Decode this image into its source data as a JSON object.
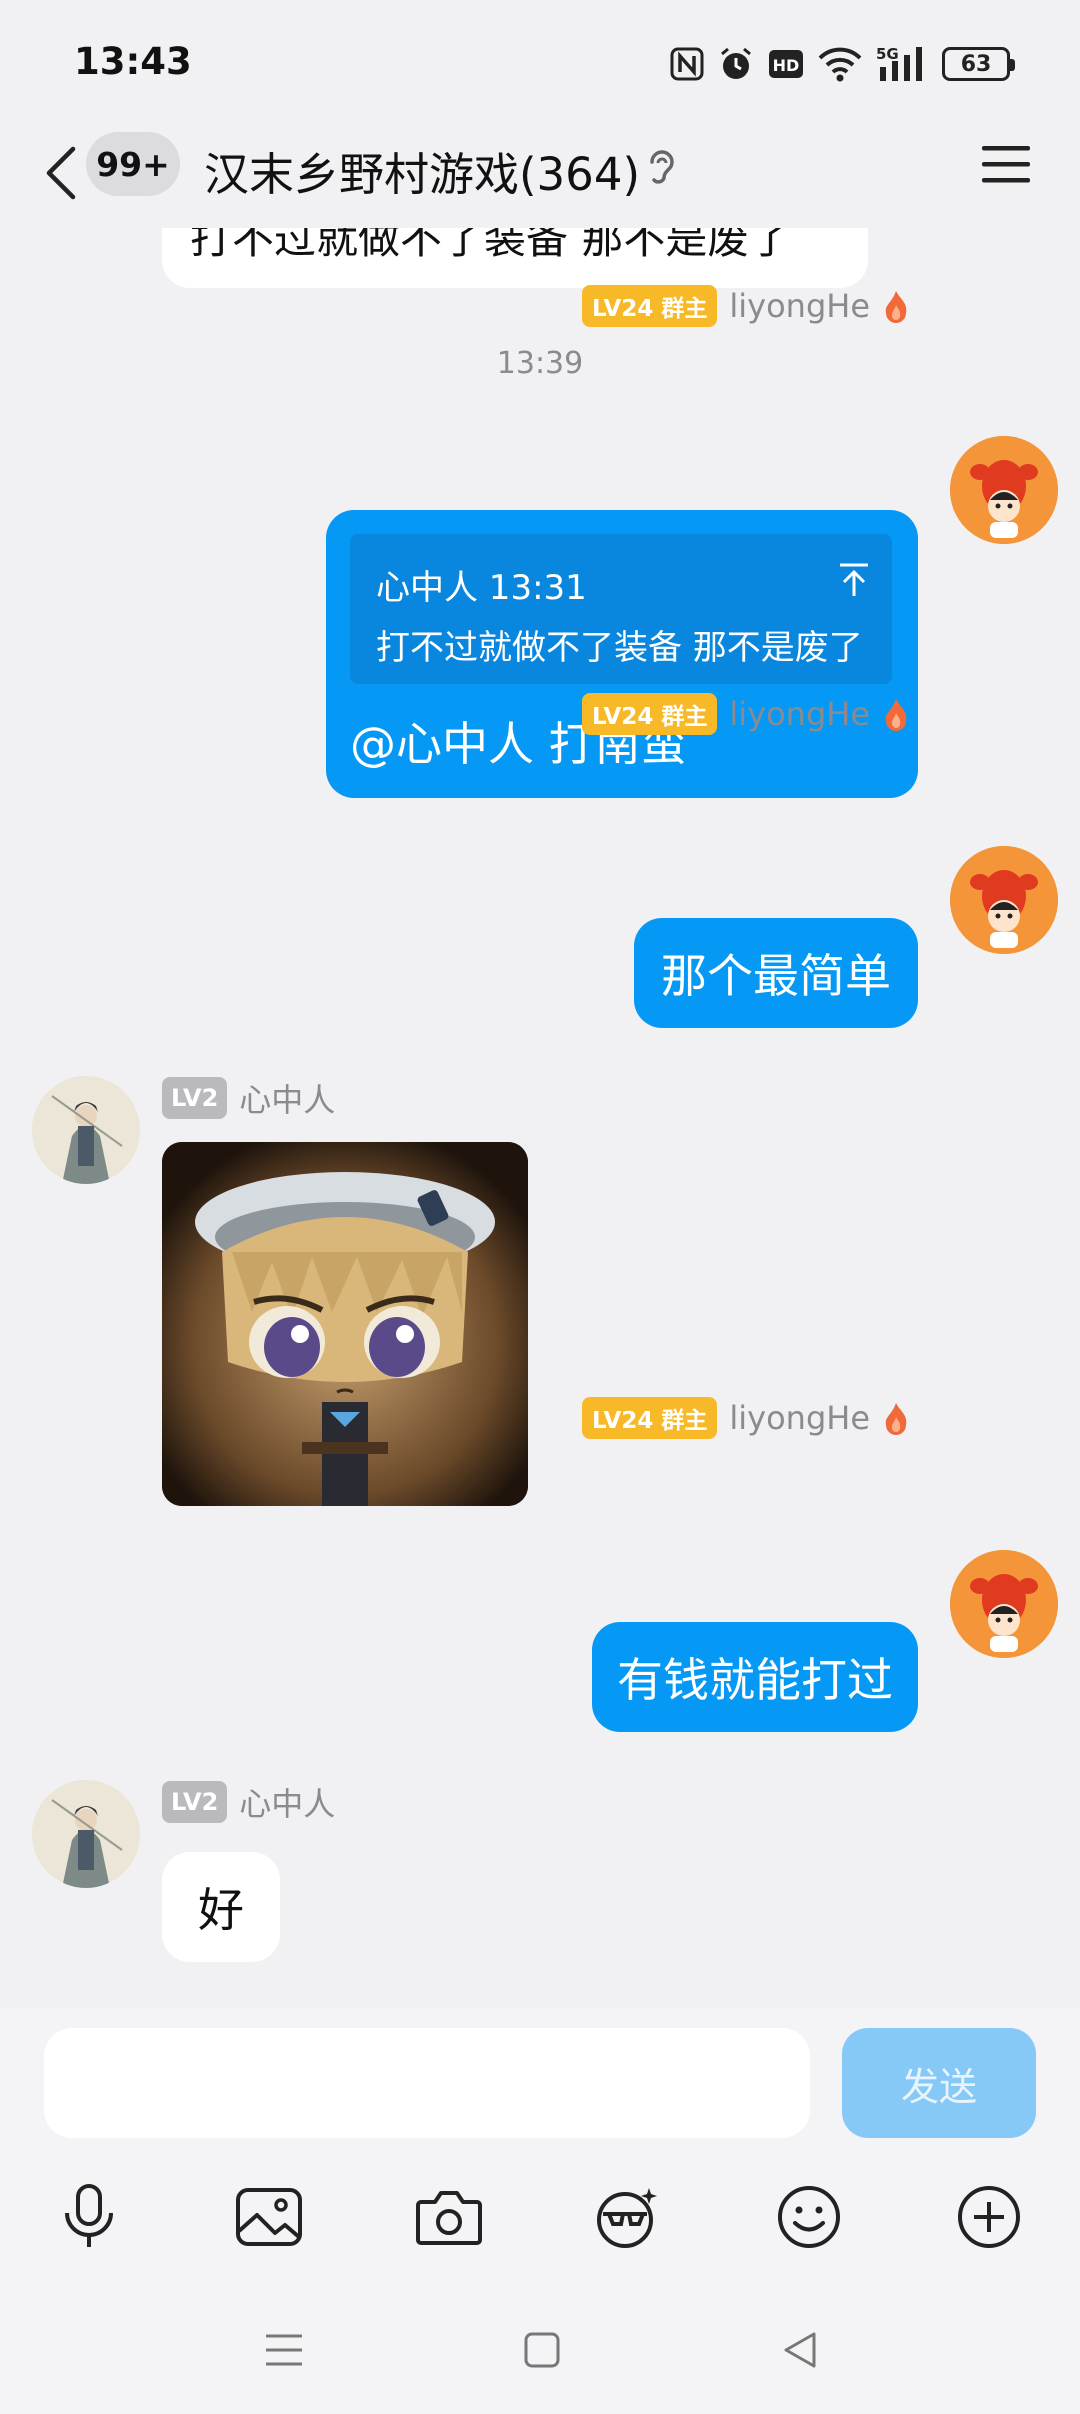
{
  "status_bar": {
    "time": "13:43",
    "network": "5G",
    "hd": "HD",
    "battery": "63"
  },
  "header": {
    "unread_count": "99+",
    "title": "汉末乡野村游戏(364)"
  },
  "messages": {
    "top_partial_text": "打不过就做不了装备 那不是废了",
    "timestamp": "13:39",
    "msg1": {
      "badge": "LV24 群主",
      "sender": "liyongHe",
      "quote_sender_time": "心中人 13:31",
      "quote_text": "打不过就做不了装备 那不是废了",
      "text": "@心中人 打南蛮"
    },
    "msg2": {
      "badge": "LV24 群主",
      "sender": "liyongHe",
      "text": "那个最简单"
    },
    "msg3": {
      "badge": "LV2",
      "sender": "心中人"
    },
    "msg4": {
      "badge": "LV24 群主",
      "sender": "liyongHe",
      "text": "有钱就能打过"
    },
    "msg5": {
      "badge": "LV2",
      "sender": "心中人",
      "text": "好"
    }
  },
  "input": {
    "value": "",
    "send_label": "发送"
  },
  "toolbar": [
    "microphone-icon",
    "image-icon",
    "camera-icon",
    "sticker-icon",
    "emoji-icon",
    "plus-icon"
  ],
  "colors": {
    "bubble_blue": "#0599f5",
    "owner_badge": "#f7b928",
    "send_disabled": "#86c9f7",
    "background": "#f1f1f4"
  }
}
